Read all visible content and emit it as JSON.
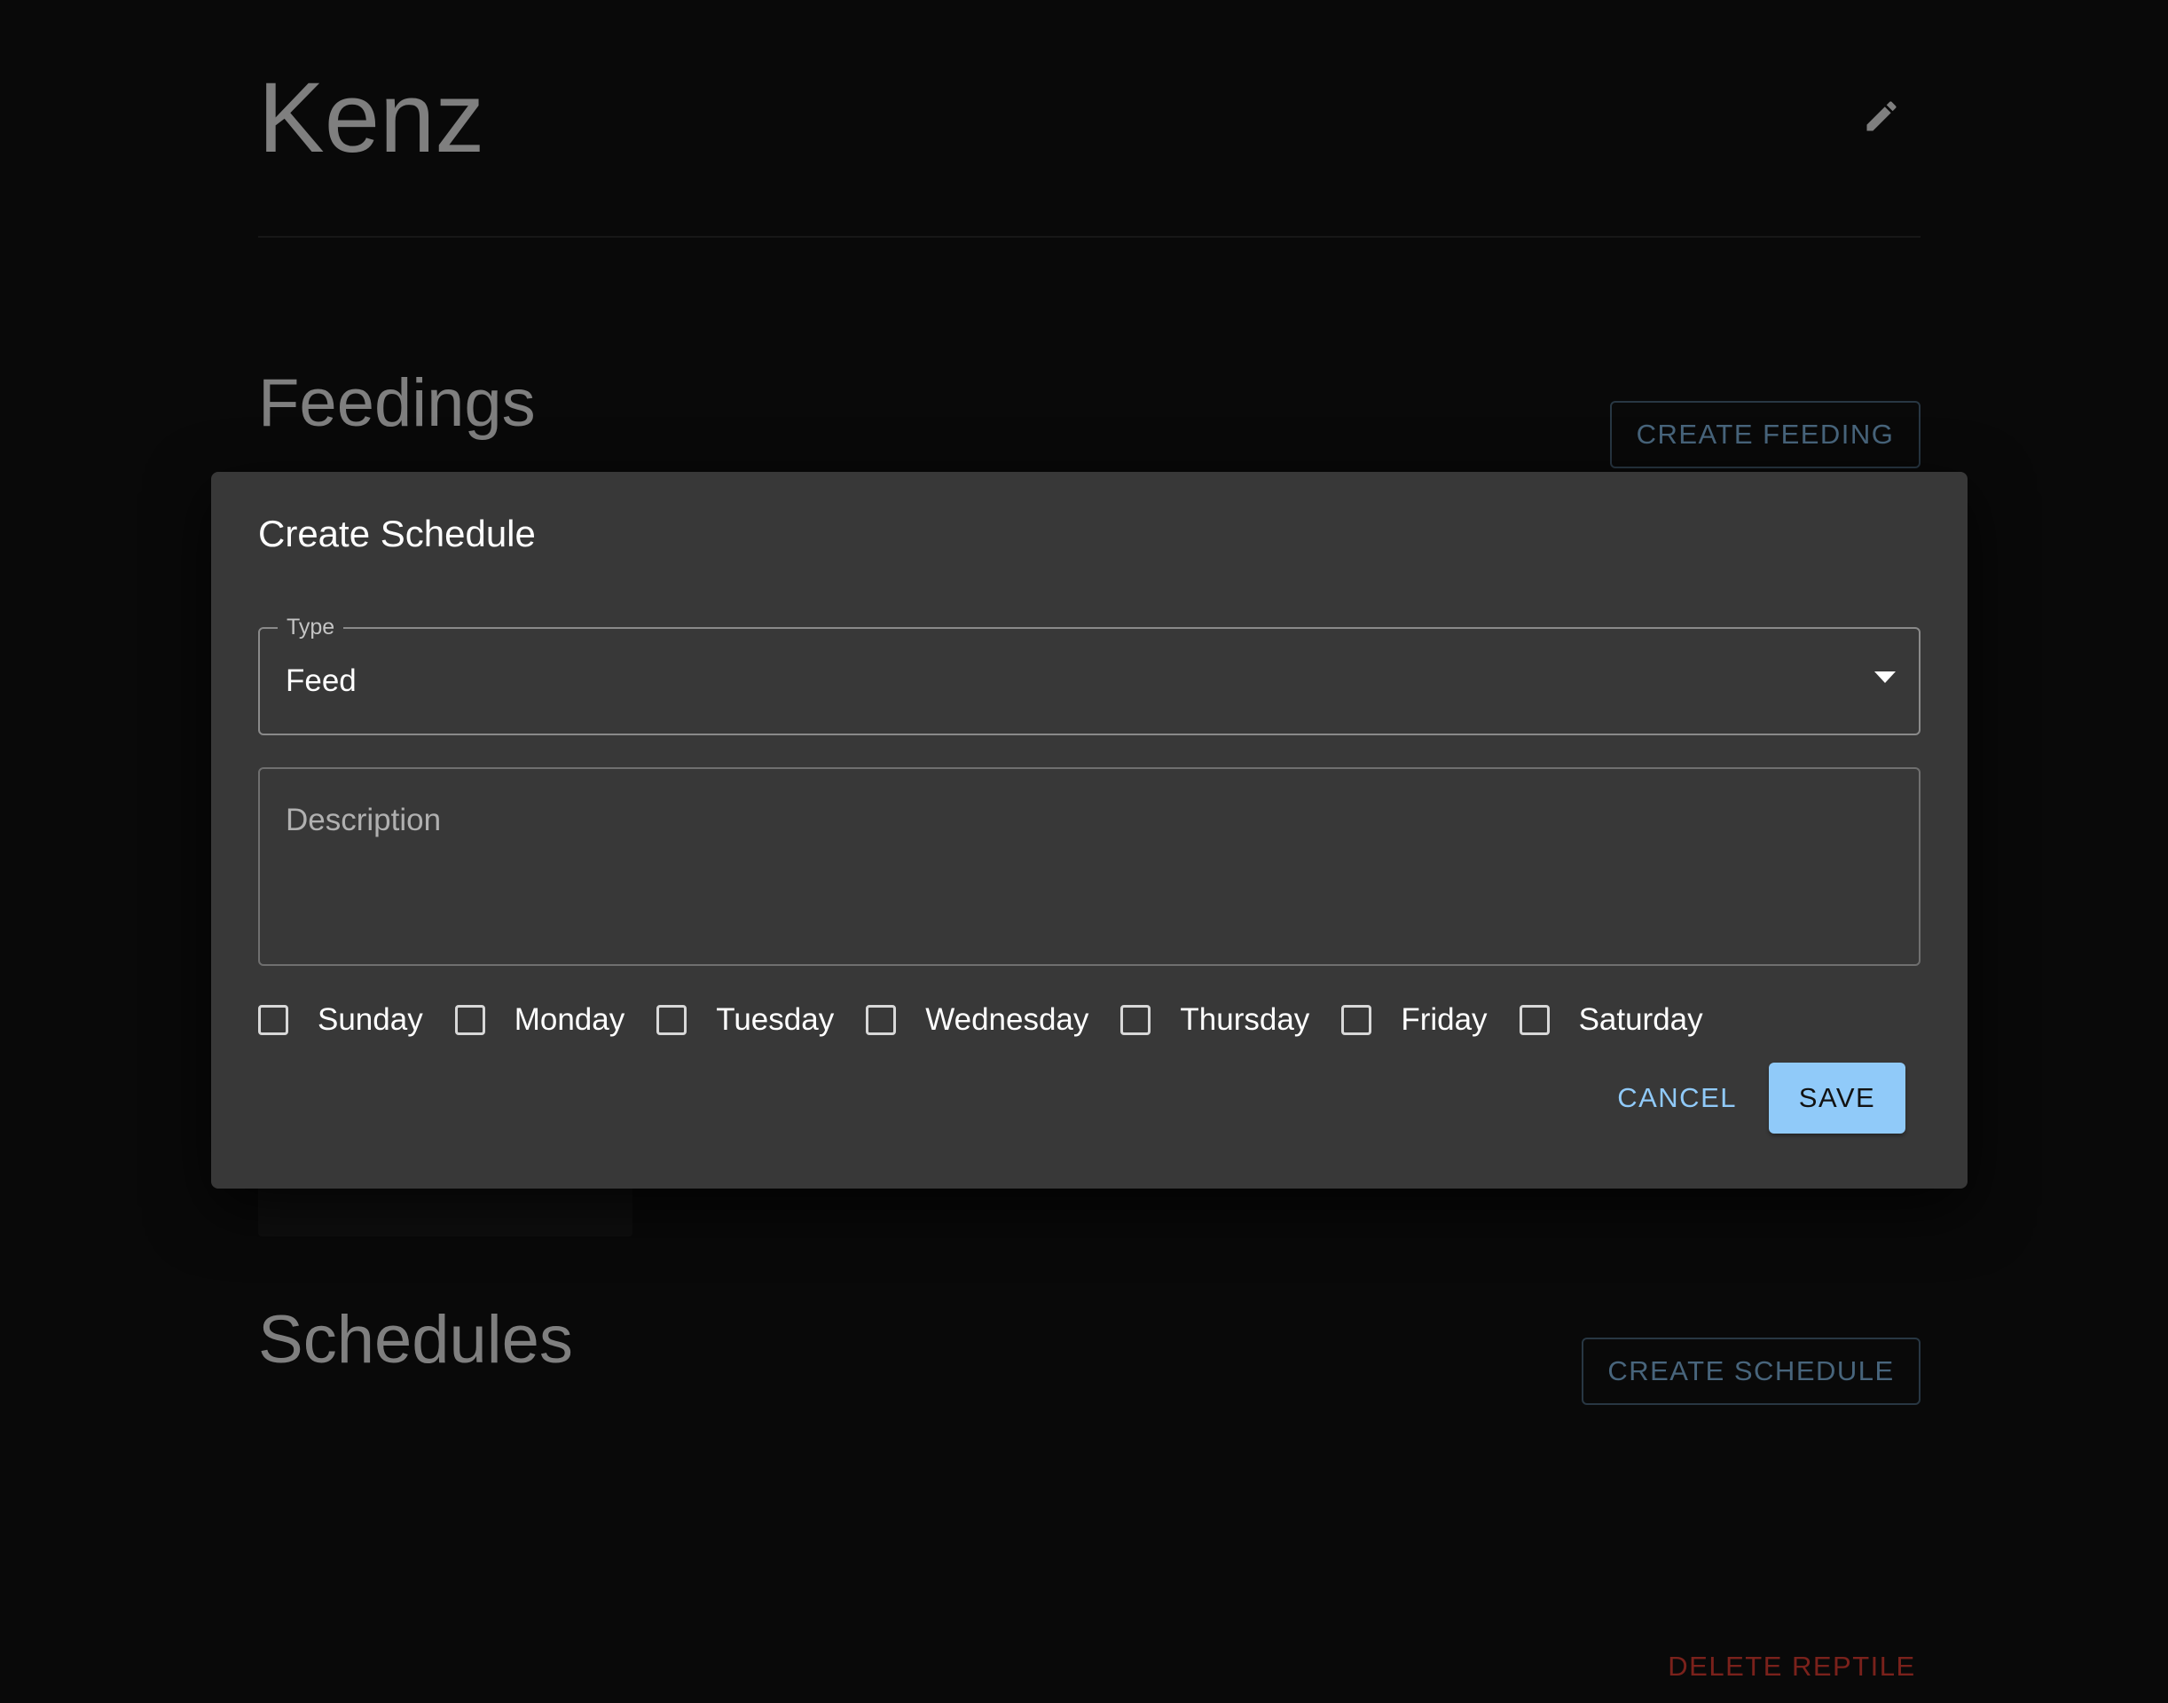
{
  "reptile": {
    "name": "Kenz"
  },
  "feedings": {
    "title": "Feedings",
    "create_label": "CREATE FEEDING"
  },
  "schedules": {
    "title": "Schedules",
    "create_label": "CREATE SCHEDULE"
  },
  "delete_label": "DELETE REPTILE",
  "dialog": {
    "title": "Create Schedule",
    "type_field": {
      "label": "Type",
      "value": "Feed"
    },
    "description_field": {
      "placeholder": "Description",
      "value": ""
    },
    "days": [
      {
        "label": "Sunday",
        "checked": false
      },
      {
        "label": "Monday",
        "checked": false
      },
      {
        "label": "Tuesday",
        "checked": false
      },
      {
        "label": "Wednesday",
        "checked": false
      },
      {
        "label": "Thursday",
        "checked": false
      },
      {
        "label": "Friday",
        "checked": false
      },
      {
        "label": "Saturday",
        "checked": false
      }
    ],
    "cancel_label": "CANCEL",
    "save_label": "SAVE"
  },
  "icons": {
    "edit": "pencil-icon",
    "select_arrow": "arrow-drop-down-icon",
    "checkbox": "checkbox-outline-blank-icon"
  },
  "colors": {
    "background": "#121212",
    "dialog": "#383838",
    "primary": "#90caf9",
    "error": "#f44336"
  }
}
